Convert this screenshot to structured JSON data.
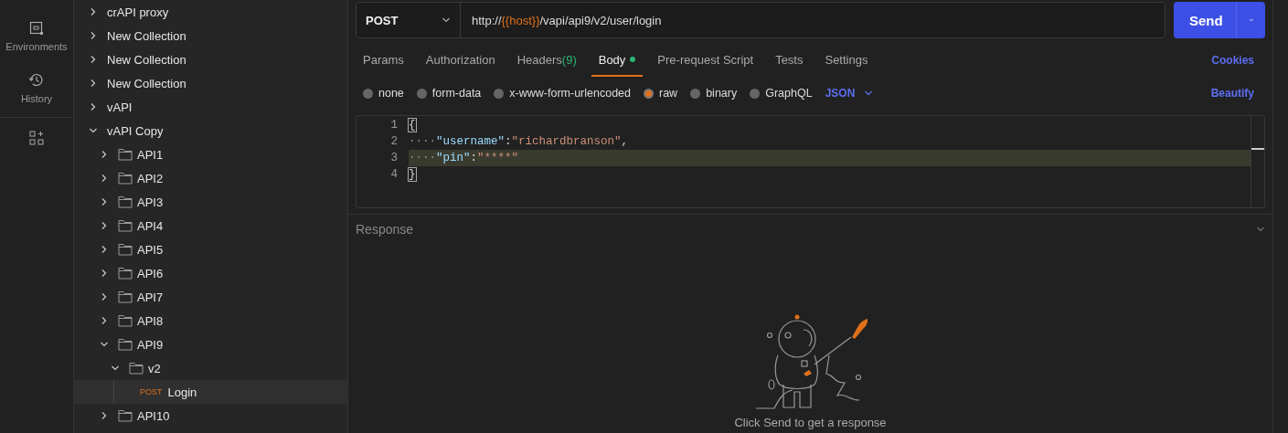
{
  "nav_rail": [
    {
      "kind": "environments",
      "label": "Environments"
    },
    {
      "kind": "history",
      "label": "History"
    },
    {
      "kind": "add-widgets"
    }
  ],
  "collections": [
    {
      "name": "crAPI proxy",
      "kind": "collection",
      "expanded": false,
      "selected": false
    },
    {
      "name": "New Collection",
      "kind": "collection",
      "expanded": false,
      "selected": false
    },
    {
      "name": "New Collection",
      "kind": "collection",
      "expanded": false,
      "selected": false
    },
    {
      "name": "New Collection",
      "kind": "collection",
      "expanded": false,
      "selected": false
    },
    {
      "name": "vAPI",
      "kind": "collection",
      "expanded": false,
      "selected": false
    },
    {
      "name": "vAPI Copy",
      "kind": "collection",
      "expanded": true,
      "selected": false,
      "children": [
        {
          "name": "API1",
          "kind": "folder",
          "expanded": false,
          "selected": false
        },
        {
          "name": "API2",
          "kind": "folder",
          "expanded": false,
          "selected": false
        },
        {
          "name": "API3",
          "kind": "folder",
          "expanded": false,
          "selected": false
        },
        {
          "name": "API4",
          "kind": "folder",
          "expanded": false,
          "selected": false
        },
        {
          "name": "API5",
          "kind": "folder",
          "expanded": false,
          "selected": false
        },
        {
          "name": "API6",
          "kind": "folder",
          "expanded": false,
          "selected": false
        },
        {
          "name": "API7",
          "kind": "folder",
          "expanded": false,
          "selected": false
        },
        {
          "name": "API8",
          "kind": "folder",
          "expanded": false,
          "selected": false
        },
        {
          "name": "API9",
          "kind": "folder",
          "expanded": true,
          "selected": false,
          "children": [
            {
              "name": "v2",
              "kind": "folder",
              "expanded": true,
              "selected": false,
              "children": [
                {
                  "name": "Login",
                  "kind": "request",
                  "method": "POST",
                  "selected": true
                }
              ]
            }
          ]
        },
        {
          "name": "API10",
          "kind": "folder",
          "expanded": false,
          "selected": false
        }
      ]
    }
  ],
  "request": {
    "method": "POST",
    "url_parts": [
      {
        "kind": "plain",
        "text": "http://"
      },
      {
        "kind": "variable",
        "text": "{{host}}"
      },
      {
        "kind": "plain",
        "text": "/vapi/api9/v2/user/login"
      }
    ],
    "send_label": "Send"
  },
  "tabs": [
    {
      "label": "Params",
      "selected": false
    },
    {
      "label": "Authorization",
      "selected": false
    },
    {
      "label": "Headers",
      "count": "(9)",
      "selected": false
    },
    {
      "label": "Body",
      "has_content": true,
      "selected": true
    },
    {
      "label": "Pre-request Script",
      "selected": false
    },
    {
      "label": "Tests",
      "selected": false
    },
    {
      "label": "Settings",
      "selected": false
    }
  ],
  "cookies_link": "Cookies",
  "body_types": [
    {
      "label": "none",
      "selected": false
    },
    {
      "label": "form-data",
      "selected": false
    },
    {
      "label": "x-www-form-urlencoded",
      "selected": false
    },
    {
      "label": "raw",
      "selected": true
    },
    {
      "label": "binary",
      "selected": false
    },
    {
      "label": "GraphQL",
      "selected": false
    }
  ],
  "language": "JSON",
  "beautify_link": "Beautify",
  "code_lines": [
    {
      "number": "1",
      "active": false,
      "tokens": [
        {
          "kind": "bracket-match",
          "text": "{"
        }
      ]
    },
    {
      "number": "2",
      "active": false,
      "tokens": [
        {
          "kind": "whitespace",
          "text": "····"
        },
        {
          "kind": "key",
          "text": "\"username\""
        },
        {
          "kind": "punct",
          "text": ":"
        },
        {
          "kind": "string",
          "text": "\"richardbranson\""
        },
        {
          "kind": "punct",
          "text": ","
        }
      ]
    },
    {
      "number": "3",
      "active": true,
      "tokens": [
        {
          "kind": "whitespace",
          "text": "····"
        },
        {
          "kind": "key",
          "text": "\"pin\""
        },
        {
          "kind": "punct",
          "text": ":"
        },
        {
          "kind": "string",
          "text": "\"****\""
        }
      ]
    },
    {
      "number": "4",
      "active": false,
      "tokens": [
        {
          "kind": "bracket-match",
          "text": "}"
        }
      ]
    }
  ],
  "response": {
    "title": "Response",
    "empty_message": "Click Send to get a response"
  }
}
